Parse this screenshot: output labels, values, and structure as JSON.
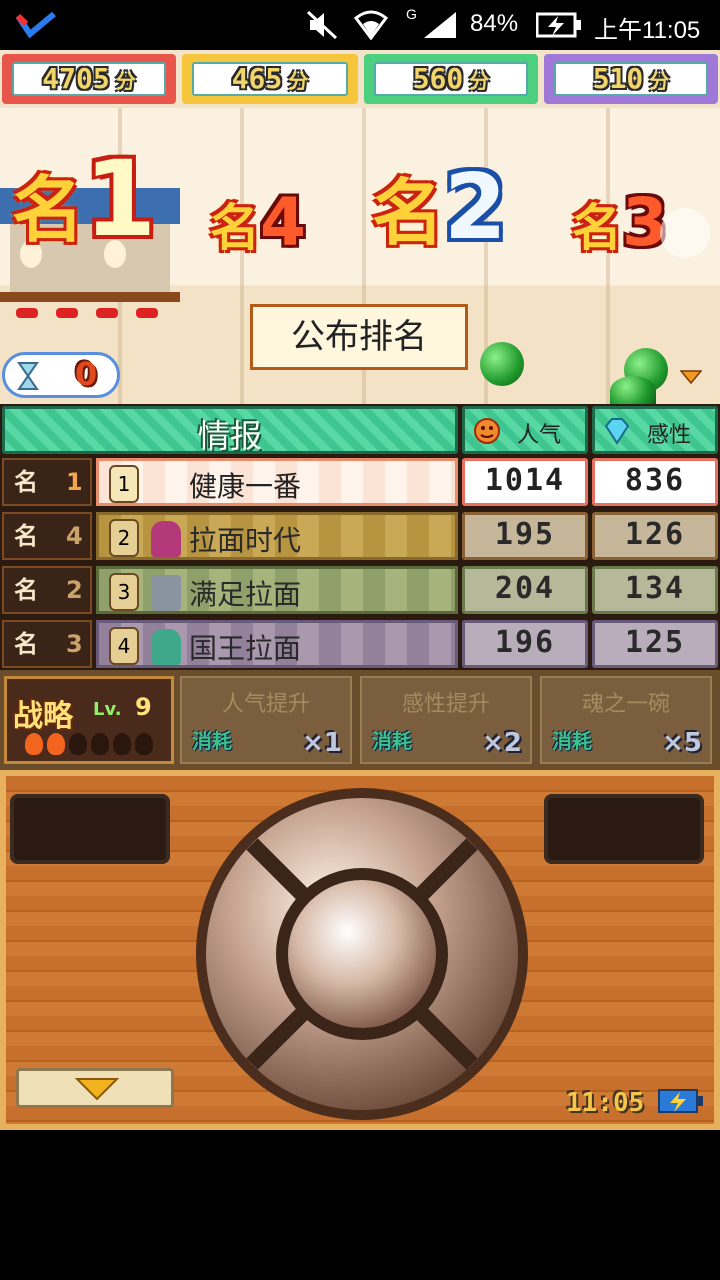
{
  "status_bar": {
    "battery": "84%",
    "signal_label": "G",
    "time": "上午11:05"
  },
  "money": [
    {
      "value": "4705",
      "unit": "分",
      "color": "#e8554a"
    },
    {
      "value": "465",
      "unit": "分",
      "color": "#f5c53b"
    },
    {
      "value": "560",
      "unit": "分",
      "color": "#4ccf7f"
    },
    {
      "value": "510",
      "unit": "分",
      "color": "#a079d8"
    }
  ],
  "ranks_top": [
    {
      "label": "名",
      "number": "1"
    },
    {
      "label": "名",
      "number": "4"
    },
    {
      "label": "名",
      "number": "2"
    },
    {
      "label": "名",
      "number": "3"
    }
  ],
  "announce_label": "公布排名",
  "timer_value": "0",
  "table": {
    "title": "情报",
    "col_popularity": "人气",
    "col_sense": "感性",
    "rows": [
      {
        "rank_label": "名",
        "rank": "1",
        "no": "1",
        "name": "健康一番",
        "popularity": "1014",
        "sense": "836",
        "bg": "#f8d8c8"
      },
      {
        "rank_label": "名",
        "rank": "4",
        "no": "2",
        "name": "拉面时代",
        "popularity": "195",
        "sense": "126",
        "bg": "#c8a64a"
      },
      {
        "rank_label": "名",
        "rank": "2",
        "no": "3",
        "name": "满足拉面",
        "popularity": "204",
        "sense": "134",
        "bg": "#9aa970"
      },
      {
        "rank_label": "名",
        "rank": "3",
        "no": "4",
        "name": "国王拉面",
        "popularity": "196",
        "sense": "125",
        "bg": "#a18ea4"
      }
    ]
  },
  "strategy": {
    "title": "战略",
    "level_label": "Lv.",
    "level": "9",
    "skills": [
      {
        "name": "人气提升",
        "cost_label": "消耗",
        "mult": "×1"
      },
      {
        "name": "感性提升",
        "cost_label": "消耗",
        "mult": "×2"
      },
      {
        "name": "魂之一碗",
        "cost_label": "消耗",
        "mult": "×5"
      }
    ]
  },
  "clock": "11:05"
}
